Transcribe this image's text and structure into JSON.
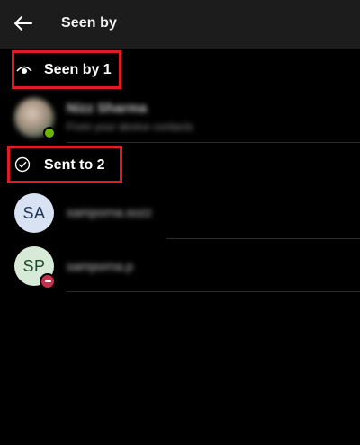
{
  "header": {
    "title": "Seen by",
    "back_icon": "arrow-left-icon"
  },
  "seen_section": {
    "label": "Seen by 1",
    "icon": "eye-icon"
  },
  "seen_people": [
    {
      "name": "Nizz Sharma",
      "subtitle": "From your device contacts",
      "avatar_style": "photo-blurred",
      "presence": "available"
    }
  ],
  "sent_section": {
    "label": "Sent to 2",
    "icon": "check-circle-icon"
  },
  "sent_people": [
    {
      "initials": "SA",
      "name": "samporna.sozz",
      "avatar_color": "#d8e2f3",
      "presence": "none"
    },
    {
      "initials": "SP",
      "name": "samporna.p",
      "avatar_color": "#d7ead8",
      "presence": "do-not-disturb"
    }
  ],
  "colors": {
    "background": "#000000",
    "header_bg": "#1c1c1c",
    "highlight": "#e01b24",
    "dnd": "#c4314b"
  }
}
